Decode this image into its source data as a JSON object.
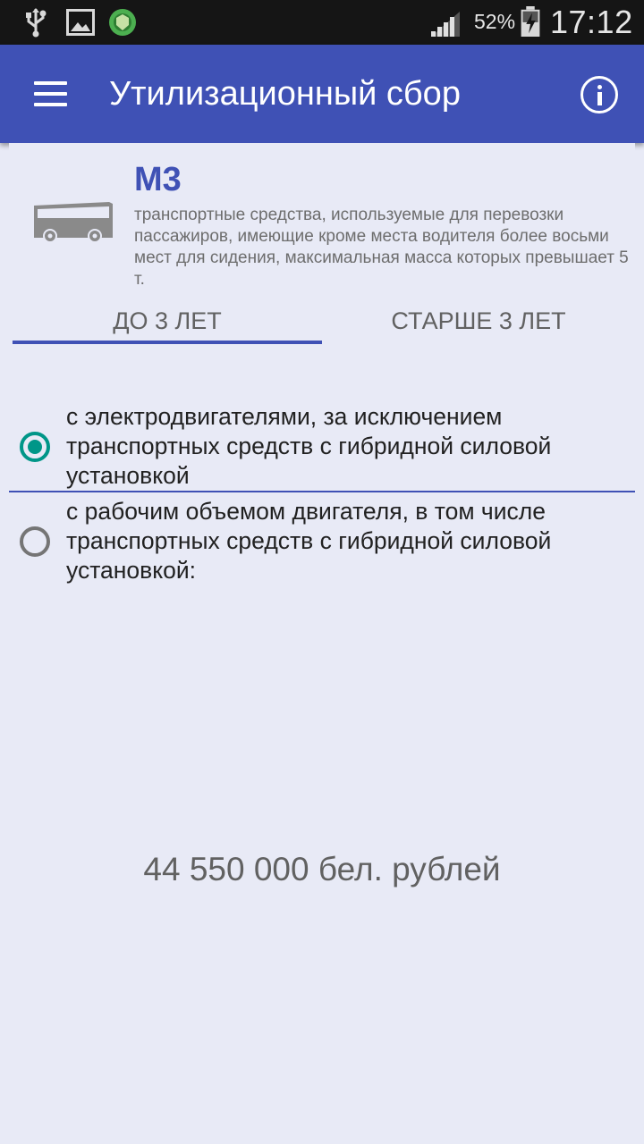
{
  "status_bar": {
    "icons": [
      "usb-icon",
      "gallery-icon",
      "app-shield-icon",
      "signal-icon",
      "battery-charging-icon"
    ],
    "battery_percent": "52%",
    "time": "17:12"
  },
  "app_bar": {
    "title": "Утилизационный сбор",
    "menu_icon": "hamburger-menu-icon",
    "info_icon": "info-icon",
    "color": "#3f51b5"
  },
  "category": {
    "icon": "bus-icon",
    "code": "М3",
    "description": "транспортные средства, используемые для перевозки пассажиров, имеющие кроме места водителя более восьми мест для сидения, максимальная масса которых превышает 5 т."
  },
  "tabs": [
    {
      "label": "ДО 3 ЛЕТ",
      "selected": true
    },
    {
      "label": "СТАРШЕ 3 ЛЕТ",
      "selected": false
    }
  ],
  "options": [
    {
      "label": "с электродвигателями, за исключением транспортных средств с гибридной силовой установкой",
      "selected": true
    },
    {
      "label": "с рабочим объемом двигателя, в том числе транспортных средств с гибридной силовой установкой:",
      "selected": false
    }
  ],
  "result": {
    "text": "44 550 000 бел. рублей"
  },
  "colors": {
    "accent": "#009688",
    "primary": "#3f51b5",
    "background": "#e8eaf6"
  }
}
